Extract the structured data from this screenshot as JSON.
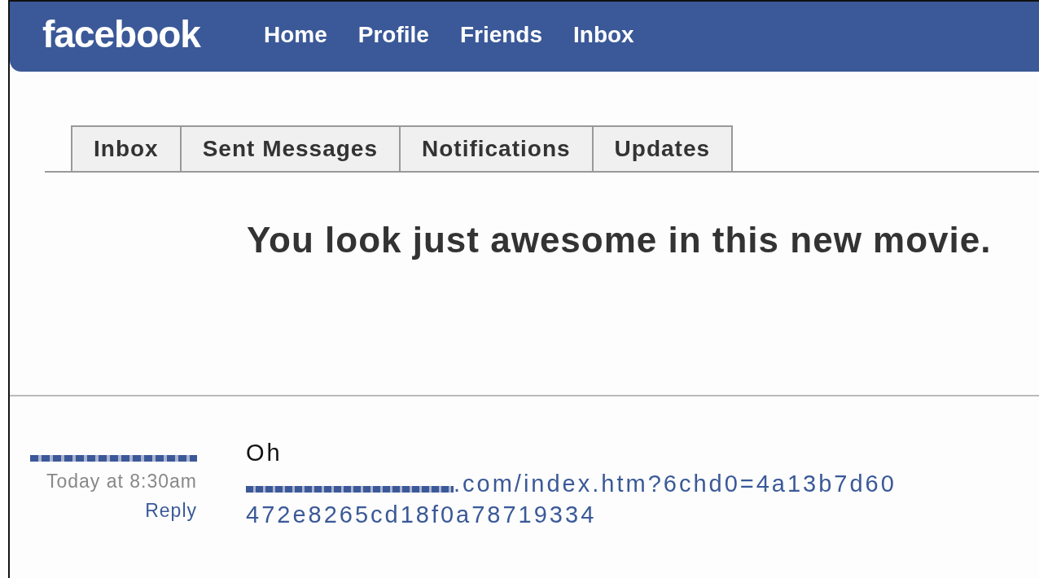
{
  "header": {
    "logo": "facebook",
    "nav": [
      "Home",
      "Profile",
      "Friends",
      "Inbox"
    ]
  },
  "tabs": [
    {
      "label": "Inbox",
      "selected": false
    },
    {
      "label": "Sent Messages",
      "selected": false
    },
    {
      "label": "Notifications",
      "selected": false
    },
    {
      "label": "Updates",
      "selected": false
    }
  ],
  "subject": "You look just awesome in this new movie.",
  "message": {
    "time": "Today at 8:30am",
    "reply": "Reply",
    "body": "Oh",
    "link_visible_part": ".com/index.htm?6chd0=4a13b7d60",
    "link_second_line": "472e8265cd18f0a78719334"
  }
}
